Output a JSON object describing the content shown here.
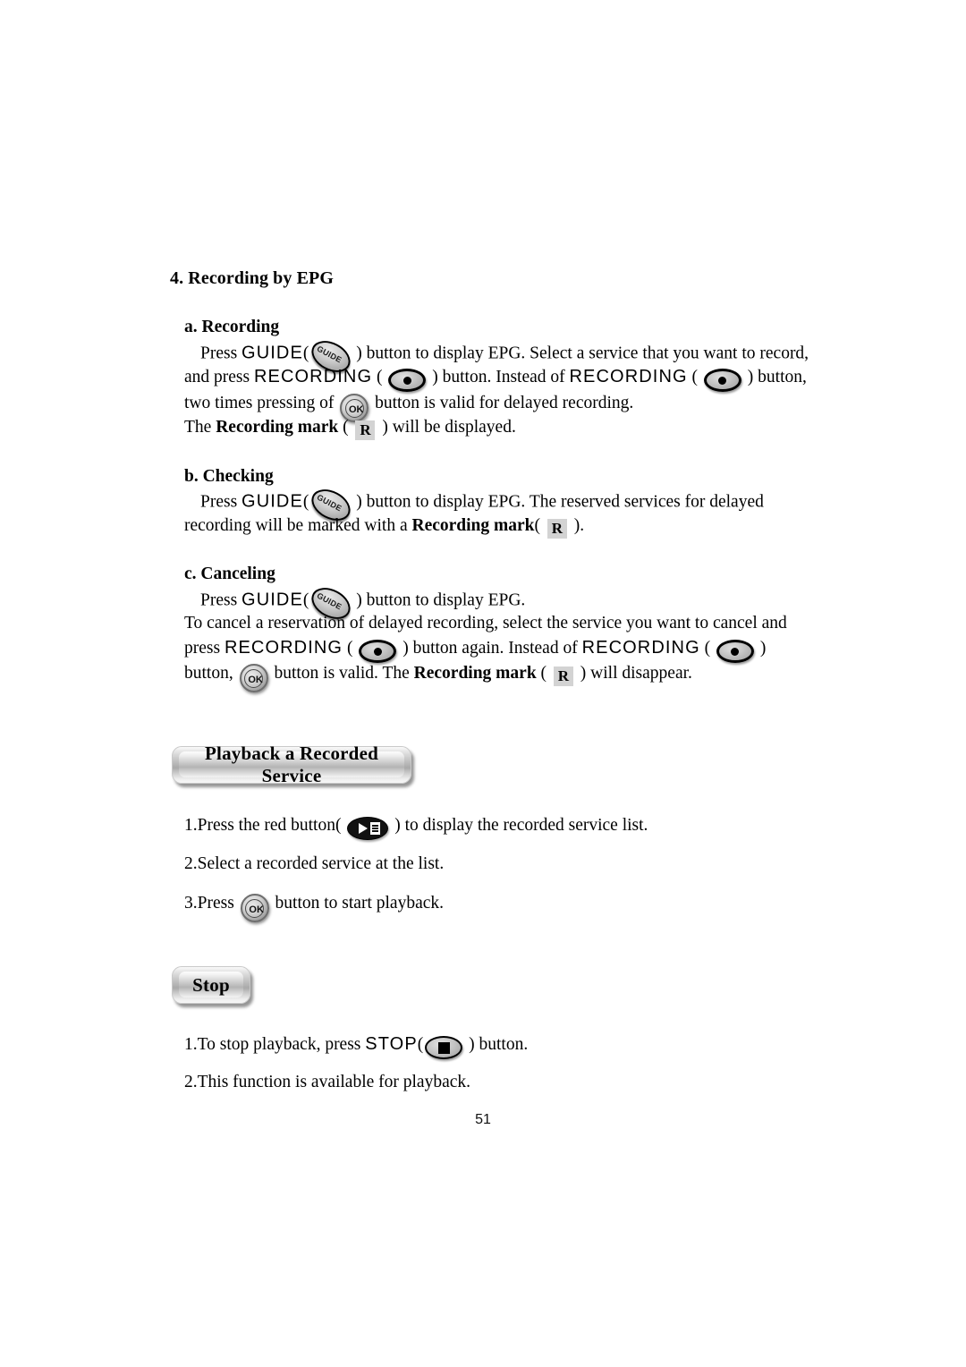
{
  "document": {
    "page_number": "51"
  },
  "section": {
    "number_title": "4. Recording by EPG",
    "sub_a": {
      "title": "a. Recording",
      "l1_pre": "Press ",
      "l1_key": "GUIDE",
      "l1_paren_open": "(",
      "l1_post": " ) button to display EPG. Select a service that you want to record,",
      "l2_pre": "and press ",
      "l2_key": "RECORDING",
      "l2_mid": " ( ",
      "l2_mid2": " ) button. Instead of ",
      "l2_key2": "RECORDING",
      "l2_mid3": " ( ",
      "l2_post": " ) button,",
      "l3_pre": "two times pressing of ",
      "l3_post": " button is valid for delayed recording.",
      "l4_pre": "The ",
      "l4_bold": "Recording mark",
      "l4_mid": " ( ",
      "l4_post": " ) will be displayed."
    },
    "sub_b": {
      "title": "b. Checking",
      "l1_pre": "Press ",
      "l1_key": "GUIDE",
      "l1_paren_open": "(",
      "l1_post": " ) button to display EPG. The reserved services for delayed",
      "l2_pre": "recording will be marked with a ",
      "l2_bold": "Recording mark",
      "l2_mid": "( ",
      "l2_post": " )."
    },
    "sub_c": {
      "title": "c. Canceling",
      "l1_pre": "Press ",
      "l1_key": "GUIDE",
      "l1_paren_open": "(",
      "l1_post": " ) button to display EPG.",
      "l2": "To cancel a reservation of delayed recording, select the service you want to cancel and",
      "l3_pre": "press ",
      "l3_key": "RECORDING",
      "l3_mid": " ( ",
      "l3_mid2": " ) button again. Instead of ",
      "l3_key2": "RECORDING",
      "l3_mid3": " ( ",
      "l3_post": " )",
      "l4_pre": "button, ",
      "l4_mid": " button is valid. The ",
      "l4_bold": "Recording mark",
      "l4_mid2": " ( ",
      "l4_post": " ) will disappear."
    }
  },
  "playback": {
    "banner_label": "Playback a Recorded Service",
    "step1_pre": "1.Press the red button( ",
    "step1_post": " ) to display the recorded service list.",
    "step2": "2.Select a recorded service at the list.",
    "step3_pre": "3.Press ",
    "step3_post": " button to start playback."
  },
  "stop": {
    "banner_label": "Stop",
    "step1_pre": "1.To stop playback, press ",
    "step1_key": "STOP",
    "step1_paren_open": "(",
    "step1_post": " ) button.",
    "step2": "2.This function is available for playback."
  },
  "icons": {
    "guide_label": "GUIDE",
    "ok_label": "OK",
    "recording_mark_label": "R"
  }
}
